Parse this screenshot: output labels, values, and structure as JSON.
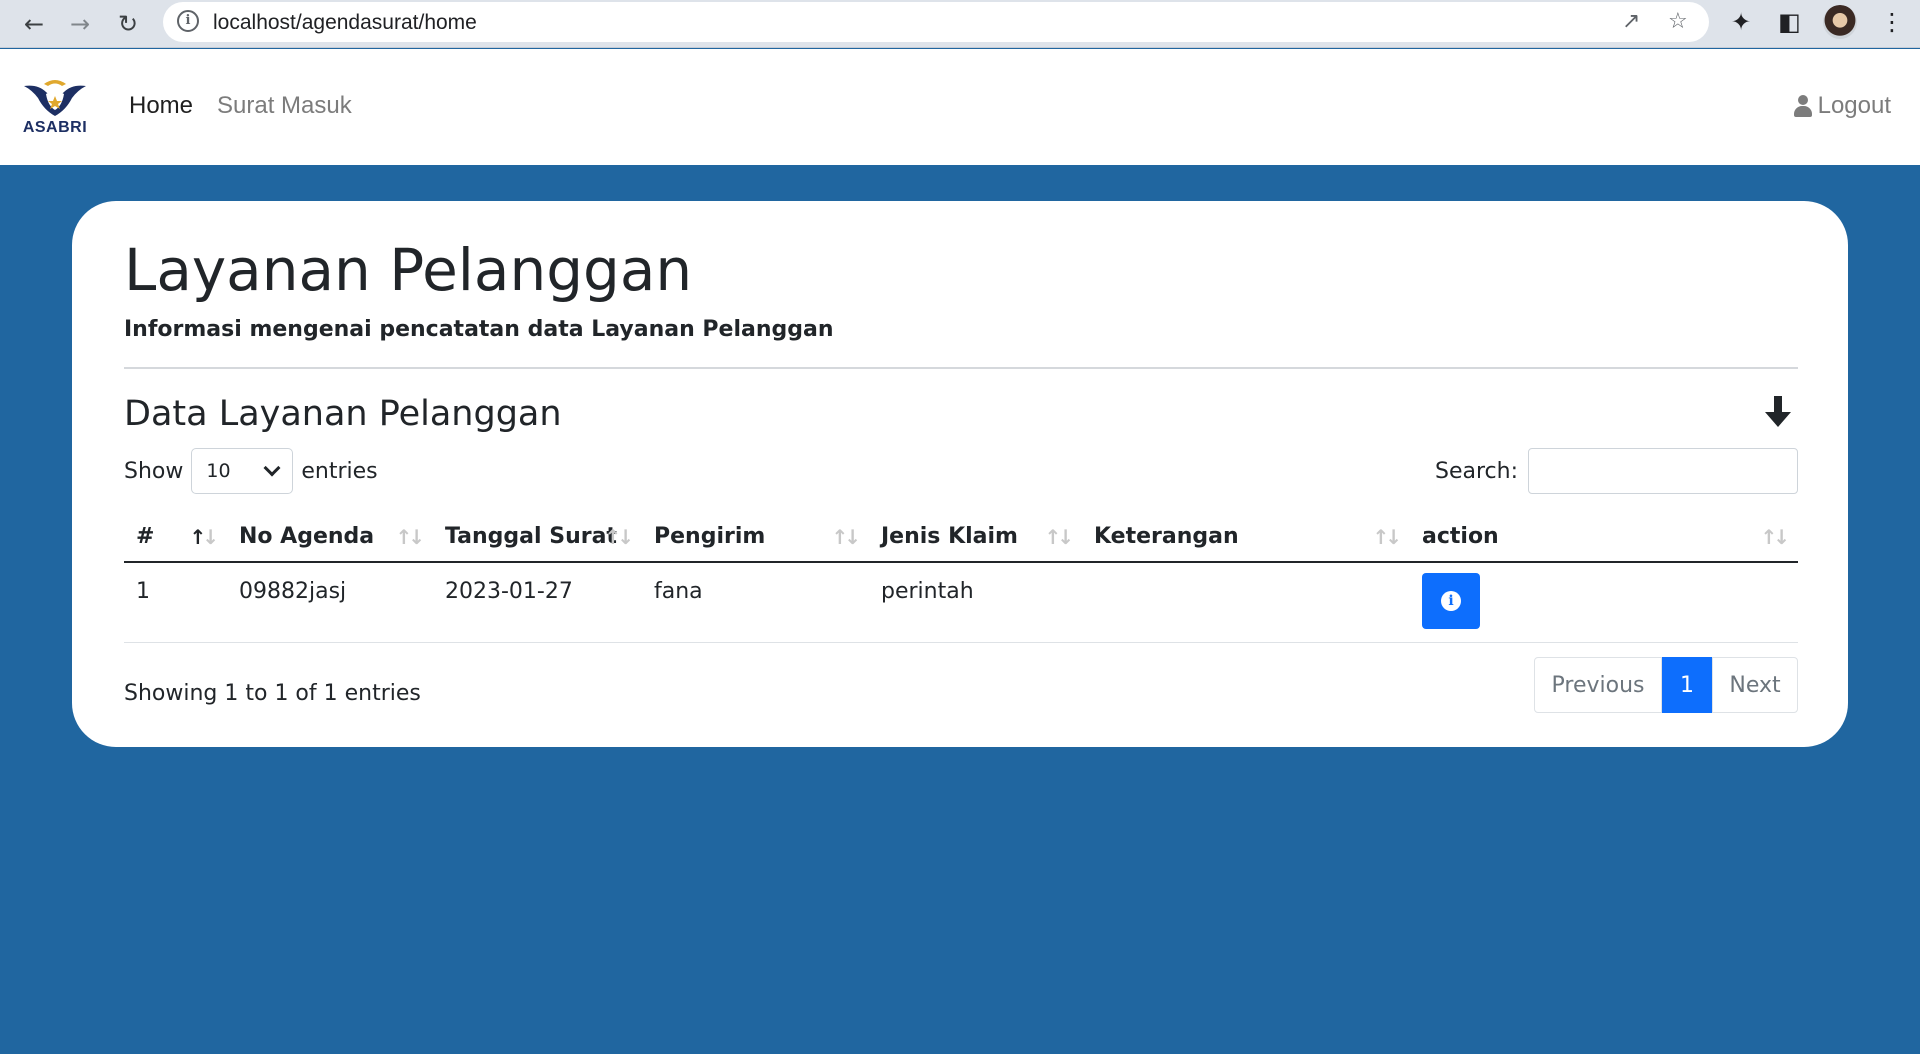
{
  "browser": {
    "url": "localhost/agendasurat/home"
  },
  "navbar": {
    "logo_text": "ASABRI",
    "links": [
      {
        "label": "Home",
        "active": true
      },
      {
        "label": "Surat Masuk",
        "active": false
      }
    ],
    "logout_label": "Logout"
  },
  "page": {
    "title": "Layanan Pelanggan",
    "subtitle": "Informasi mengenai pencatatan data Layanan Pelanggan",
    "section_title": "Data Layanan Pelanggan"
  },
  "table_controls": {
    "show_label": "Show",
    "page_length": "10",
    "entries_label": "entries",
    "search_label": "Search:",
    "search_value": ""
  },
  "table": {
    "headers": [
      "#",
      "No Agenda",
      "Tanggal Surat",
      "Pengirim",
      "Jenis Klaim",
      "Keterangan",
      "action"
    ],
    "rows": [
      {
        "no": "1",
        "no_agenda": "09882jasj",
        "tanggal_surat": "2023-01-27",
        "pengirim": "fana",
        "jenis_klaim": "perintah",
        "keterangan": ""
      }
    ]
  },
  "footer": {
    "info": "Showing 1 to 1 of 1 entries",
    "previous_label": "Previous",
    "current_page": "1",
    "next_label": "Next"
  },
  "colors": {
    "background": "#2066a0",
    "primary": "#0d6efd",
    "brand_navy": "#1d2f63",
    "brand_gold": "#e0a82e"
  }
}
